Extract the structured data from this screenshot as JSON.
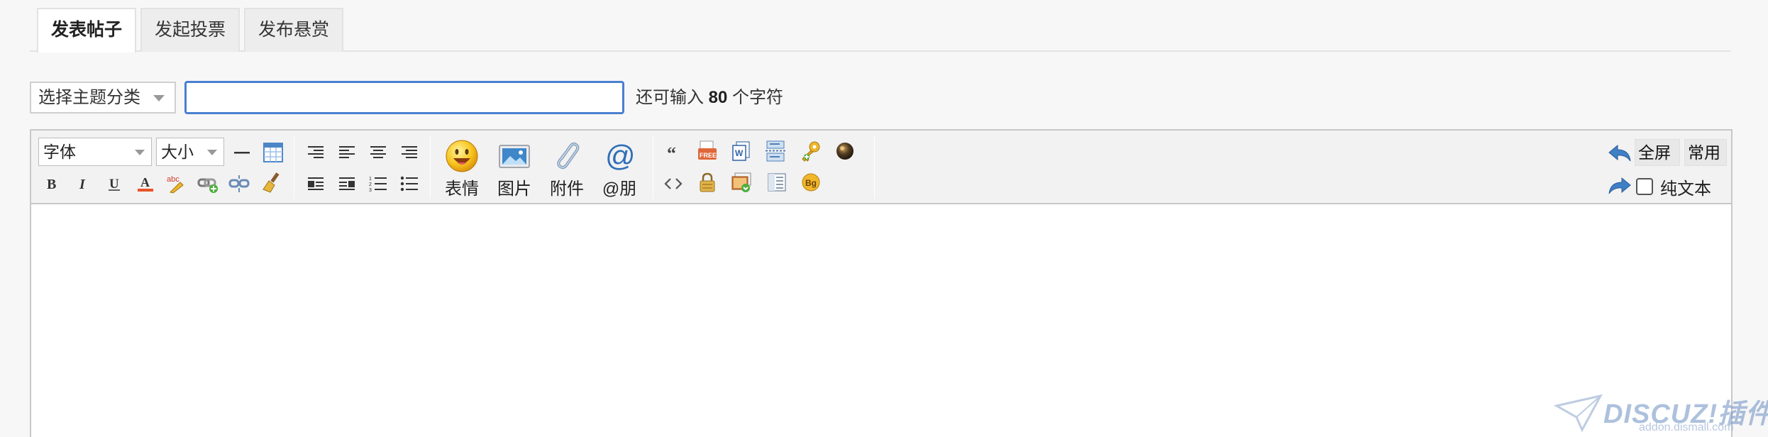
{
  "tabs": [
    {
      "label": "发表帖子",
      "active": true
    },
    {
      "label": "发起投票",
      "active": false
    },
    {
      "label": "发布悬赏",
      "active": false
    }
  ],
  "subject_row": {
    "category_select": "选择主题分类",
    "subject_value": "",
    "remain_prefix": "还可输入",
    "remain_count": "80",
    "remain_suffix": "个字符"
  },
  "toolbar": {
    "font_select": "字体",
    "size_select": "大小",
    "big_buttons": [
      {
        "label": "表情",
        "icon": "smiley-icon"
      },
      {
        "label": "图片",
        "icon": "image-icon"
      },
      {
        "label": "附件",
        "icon": "paperclip-icon"
      },
      {
        "label": "@朋",
        "icon": "at-icon"
      }
    ],
    "fullscreen_label": "全屏",
    "common_label": "常用",
    "plain_text_label": "纯文本"
  },
  "editor": {
    "content": ""
  },
  "watermark": {
    "text": "DISCUZ!插件网",
    "sub": "addon.dismall.com"
  },
  "colors": {
    "accent": "#4a7fd0",
    "toolbar_bg": "#f2f2f2",
    "page_bg": "#f7f7f7"
  }
}
